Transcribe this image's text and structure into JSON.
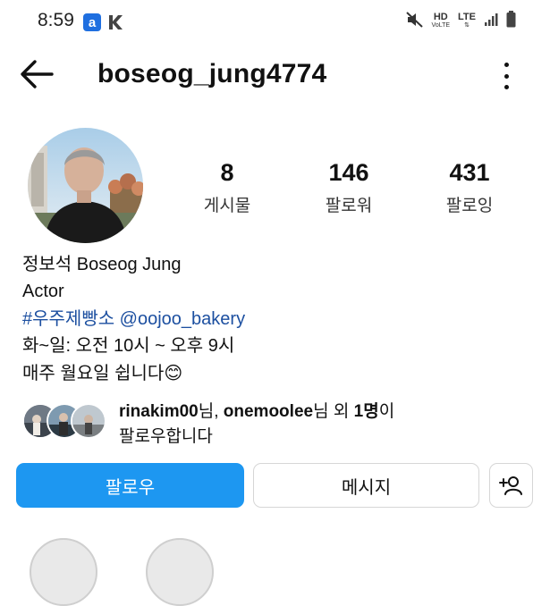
{
  "status_bar": {
    "time": "8:59",
    "app_badge_1": "a",
    "network_hd": "HD",
    "network_hd_sub": "VoLTE",
    "network_lte": "LTE",
    "icons": [
      "mute-icon",
      "signal-icon",
      "battery-icon"
    ]
  },
  "header": {
    "username": "boseog_jung4774",
    "icons": [
      "back-arrow-icon",
      "more-options-icon"
    ]
  },
  "stats": {
    "posts": {
      "count": "8",
      "label": "게시물"
    },
    "followers": {
      "count": "146",
      "label": "팔로워"
    },
    "following": {
      "count": "431",
      "label": "팔로잉"
    }
  },
  "bio": {
    "name": "정보석 Boseog Jung",
    "category": "Actor",
    "links": "#우주제빵소 @oojoo_bakery",
    "hours": "화~일: 오전 10시 ~ 오후 9시",
    "closed": "매주 월요일 쉽니다",
    "closed_emoji": "😊"
  },
  "followed_by": {
    "user1": "rinakim00",
    "suffix1": "님, ",
    "user2": "onemoolee",
    "suffix2": "님 외 ",
    "count": "1명",
    "suffix3": "이",
    "line2": "팔로우합니다"
  },
  "actions": {
    "follow_label": "팔로우",
    "message_label": "메시지"
  },
  "colors": {
    "follow_button": "#1d97f1",
    "link": "#1c4fa0"
  }
}
